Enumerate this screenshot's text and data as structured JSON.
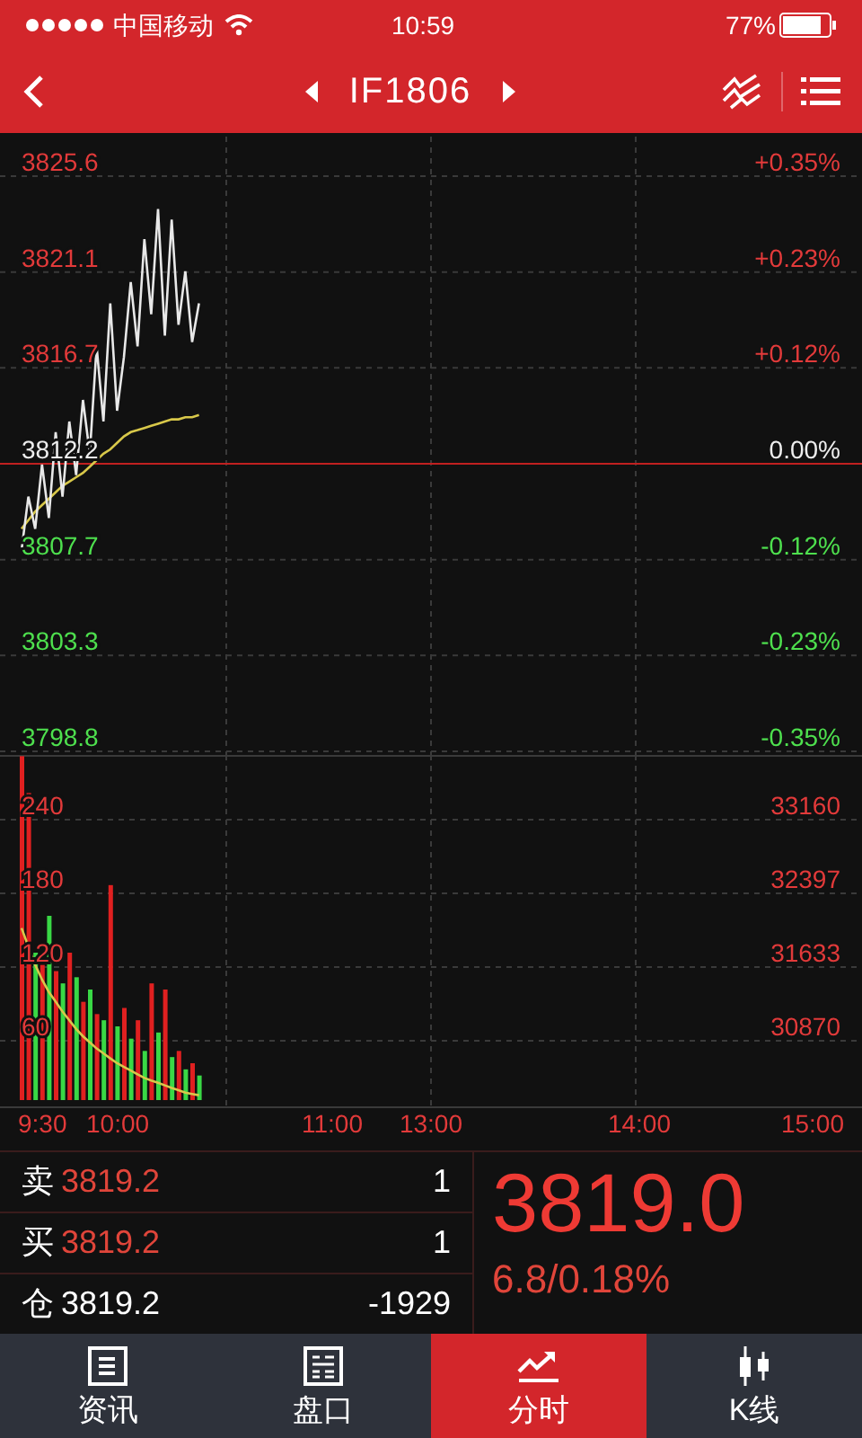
{
  "status_bar": {
    "carrier": "中国移动",
    "time": "10:59",
    "battery": "77%"
  },
  "nav": {
    "title": "IF1806"
  },
  "price_chart": {
    "left_labels": [
      "3825.6",
      "3821.1",
      "3816.7",
      "3812.2",
      "3807.7",
      "3803.3",
      "3798.8"
    ],
    "right_labels": [
      "+0.35%",
      "+0.23%",
      "+0.12%",
      "0.00%",
      "-0.12%",
      "-0.23%",
      "-0.35%"
    ]
  },
  "volume_chart": {
    "left_labels": [
      "240",
      "180",
      "120",
      "60"
    ],
    "right_labels": [
      "33160",
      "32397",
      "31633",
      "30870"
    ],
    "time_labels": [
      "9:30",
      "10:00",
      "11:00",
      "13:00",
      "14:00",
      "15:00"
    ]
  },
  "quote": {
    "rows": [
      {
        "label": "卖",
        "price": "3819.2",
        "qty": "1",
        "kind": "ask"
      },
      {
        "label": "买",
        "price": "3819.2",
        "qty": "1",
        "kind": "bid"
      },
      {
        "label": "仓",
        "price": "3819.2",
        "qty": "-1929",
        "kind": "position"
      }
    ],
    "last_price": "3819.0",
    "change": "6.8/0.18%"
  },
  "tabs": [
    {
      "label": "资讯",
      "kind": "news",
      "selected": false
    },
    {
      "label": "盘口",
      "kind": "book",
      "selected": false
    },
    {
      "label": "分时",
      "kind": "trend",
      "selected": true
    },
    {
      "label": "K线",
      "kind": "kline",
      "selected": false
    }
  ]
}
